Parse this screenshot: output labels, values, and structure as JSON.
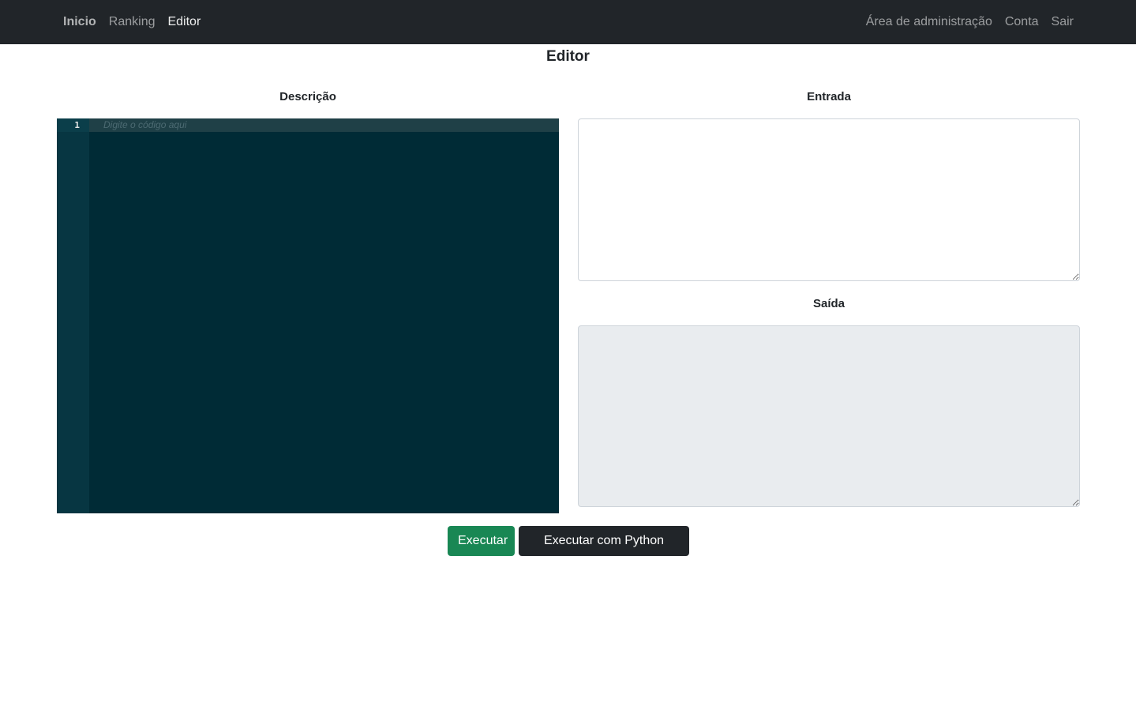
{
  "navbar": {
    "brand": "Inicio",
    "links": [
      "Ranking",
      "Editor"
    ],
    "right_links": [
      "Área de administração",
      "Conta",
      "Sair"
    ]
  },
  "page": {
    "title": "Editor"
  },
  "editor": {
    "label": "Descrição",
    "line_number": "1",
    "placeholder": "Digite o código aqui",
    "colors": {
      "background": "#002b36",
      "gutter": "#073642"
    }
  },
  "input": {
    "label": "Entrada",
    "value": ""
  },
  "output": {
    "label": "Saída",
    "value": ""
  },
  "buttons": {
    "run": "Executar",
    "python_tutor": "Executar com Python Tutor"
  },
  "colors": {
    "navbar": "#212529",
    "run_button": "#198754",
    "tutor_button": "#212529"
  }
}
